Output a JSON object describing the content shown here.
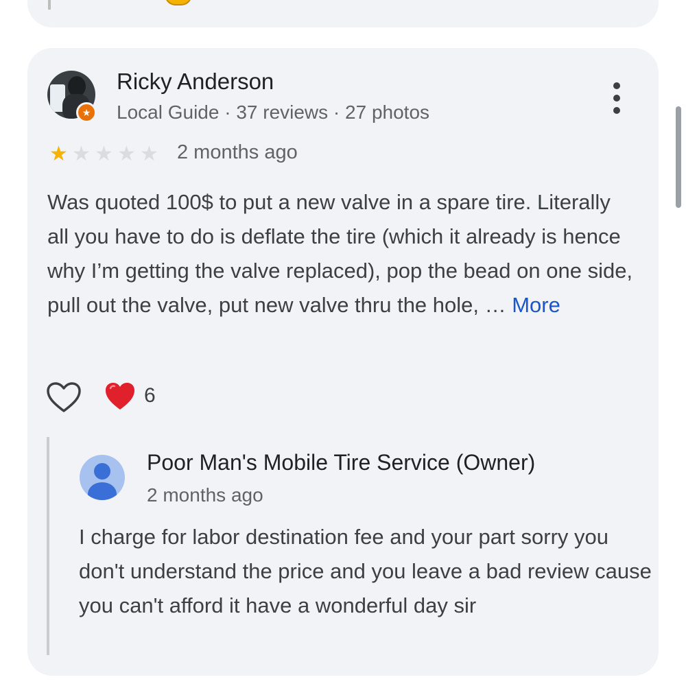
{
  "review": {
    "reviewer_name": "Ricky Anderson",
    "reviewer_meta": "Local Guide · 37 reviews · 27 photos",
    "rating": 1,
    "max_rating": 5,
    "date": "2 months ago",
    "text": "Was quoted 100$ to put a new valve in a spare tire. Literally all you have to do is deflate the tire (which it already is hence why I’m getting the valve replaced), pop the bead on one side, pull out the valve, put new valve thru the hole, … ",
    "more_label": "More",
    "reaction_count": "6"
  },
  "owner_reply": {
    "name": "Poor Man's Mobile Tire Service (Owner)",
    "date": "2 months ago",
    "text": "I charge for labor destination fee and your part sorry you don't understand the price and you leave a bad review cause you can't afford it have a wonderful day sir"
  },
  "icons": {
    "guide_badge": "local-guide-star-icon",
    "menu": "more-vert-icon",
    "like": "heart-outline-icon",
    "reaction": "red-heart-icon"
  },
  "colors": {
    "card_bg": "#f1f3f6",
    "star_filled": "#f6b400",
    "star_empty": "#dadce0",
    "link": "#1a56c8",
    "heart": "#e0202b",
    "local_guide": "#e8710a"
  }
}
